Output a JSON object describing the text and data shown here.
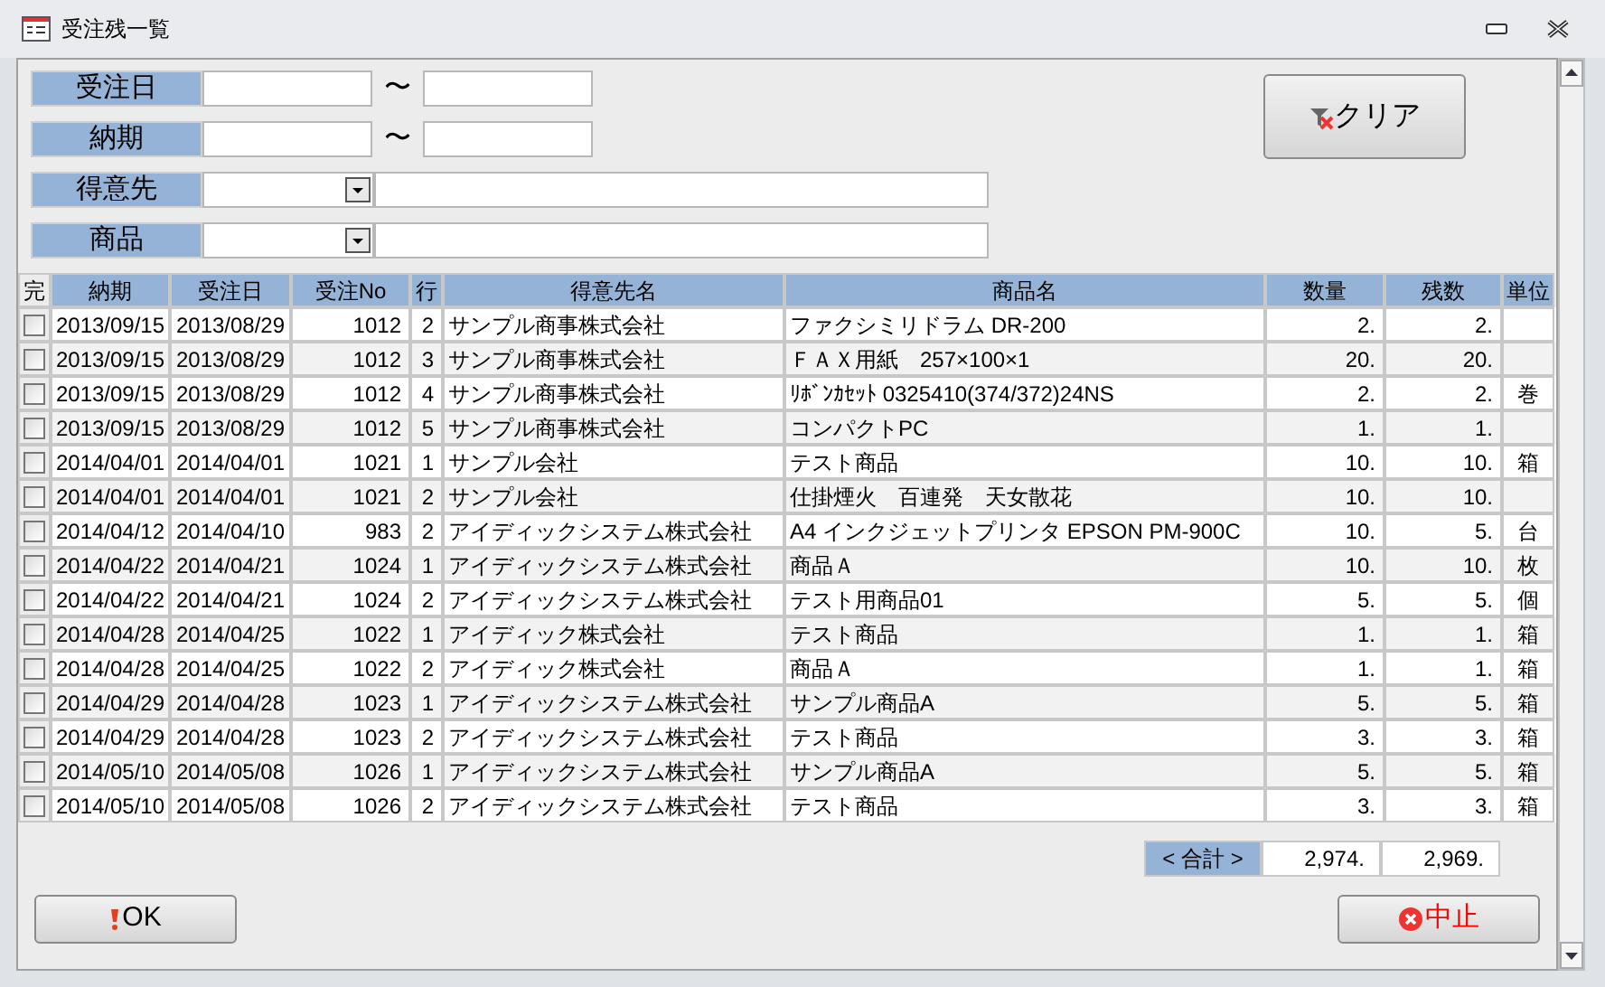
{
  "window": {
    "title": "受注残一覧"
  },
  "filters": [
    {
      "kind": "range",
      "label": "受注日",
      "separator": "〜"
    },
    {
      "kind": "range",
      "label": "納期",
      "separator": "〜"
    },
    {
      "kind": "combo",
      "label": "得意先"
    },
    {
      "kind": "combo",
      "label": "商品"
    }
  ],
  "clear_button": {
    "label": "クリア"
  },
  "table": {
    "check_column": "完",
    "columns": [
      "納期",
      "受注日",
      "受注No",
      "行",
      "得意先名",
      "商品名",
      "数量",
      "残数",
      "単位"
    ],
    "rows": [
      {
        "done": false,
        "cells": [
          "2013/09/15",
          "2013/08/29",
          "1012",
          "2",
          "サンプル商事株式会社",
          "ファクシミリドラム DR-200",
          "2.",
          "2."
        ]
      },
      {
        "done": false,
        "cells": [
          "2013/09/15",
          "2013/08/29",
          "1012",
          "3",
          "サンプル商事株式会社",
          "ＦＡＸ用紙　257×100×1",
          "20.",
          "20."
        ]
      },
      {
        "done": false,
        "cells": [
          "2013/09/15",
          "2013/08/29",
          "1012",
          "4",
          "サンプル商事株式会社",
          "ﾘﾎﾞﾝｶｾｯﾄ 0325410(374/372)24NS",
          "2.",
          "2.",
          "巻"
        ]
      },
      {
        "done": false,
        "cells": [
          "2013/09/15",
          "2013/08/29",
          "1012",
          "5",
          "サンプル商事株式会社",
          "コンパクトPC",
          "1.",
          "1."
        ]
      },
      {
        "done": false,
        "cells": [
          "2014/04/01",
          "2014/04/01",
          "1021",
          "1",
          "サンプル会社",
          "テスト商品",
          "10.",
          "10.",
          "箱"
        ]
      },
      {
        "done": false,
        "cells": [
          "2014/04/01",
          "2014/04/01",
          "1021",
          "2",
          "サンプル会社",
          "仕掛煙火　百連発　天女散花",
          "10.",
          "10."
        ]
      },
      {
        "done": false,
        "cells": [
          "2014/04/12",
          "2014/04/10",
          "983",
          "2",
          "アイディックシステム株式会社",
          "A4 インクジェットプリンタ EPSON PM-900C",
          "10.",
          "5.",
          "台"
        ]
      },
      {
        "done": false,
        "cells": [
          "2014/04/22",
          "2014/04/21",
          "1024",
          "1",
          "アイディックシステム株式会社",
          "商品Ａ",
          "10.",
          "10.",
          "枚"
        ]
      },
      {
        "done": false,
        "cells": [
          "2014/04/22",
          "2014/04/21",
          "1024",
          "2",
          "アイディックシステム株式会社",
          "テスト用商品01",
          "5.",
          "5.",
          "個"
        ]
      },
      {
        "done": false,
        "cells": [
          "2014/04/28",
          "2014/04/25",
          "1022",
          "1",
          "アイディック株式会社",
          "テスト商品",
          "1.",
          "1.",
          "箱"
        ]
      },
      {
        "done": false,
        "cells": [
          "2014/04/28",
          "2014/04/25",
          "1022",
          "2",
          "アイディック株式会社",
          "商品Ａ",
          "1.",
          "1.",
          "箱"
        ]
      },
      {
        "done": false,
        "cells": [
          "2014/04/29",
          "2014/04/28",
          "1023",
          "1",
          "アイディックシステム株式会社",
          "サンプル商品A",
          "5.",
          "5.",
          "箱"
        ]
      },
      {
        "done": false,
        "cells": [
          "2014/04/29",
          "2014/04/28",
          "1023",
          "2",
          "アイディックシステム株式会社",
          "テスト商品",
          "3.",
          "3.",
          "箱"
        ]
      },
      {
        "done": false,
        "cells": [
          "2014/05/10",
          "2014/05/08",
          "1026",
          "1",
          "アイディックシステム株式会社",
          "サンプル商品A",
          "5.",
          "5.",
          "箱"
        ]
      },
      {
        "done": false,
        "cells": [
          "2014/05/10",
          "2014/05/08",
          "1026",
          "2",
          "アイディックシステム株式会社",
          "テスト商品",
          "3.",
          "3.",
          "箱"
        ]
      }
    ]
  },
  "totals": {
    "label": "< 合計 >",
    "values": [
      "2,974.",
      "2,969."
    ]
  },
  "buttons": [
    {
      "kind": "ok",
      "label": "OK"
    },
    {
      "kind": "cancel",
      "label": "中止"
    }
  ]
}
